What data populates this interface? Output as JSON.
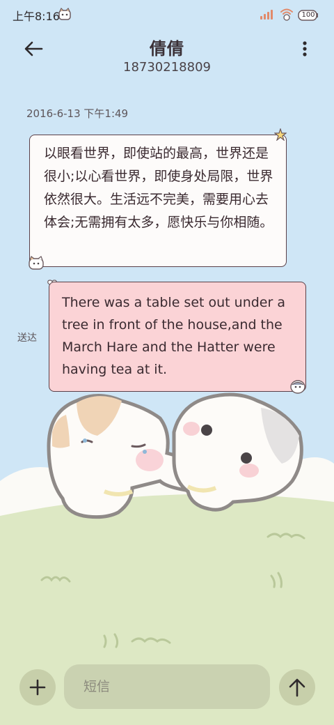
{
  "status_bar": {
    "time": "上午8:16",
    "battery": "100"
  },
  "header": {
    "contact_name": "倩倩",
    "phone_number": "18730218809"
  },
  "conversation": {
    "timestamp": "2016-6-13 下午1:49",
    "messages": [
      {
        "direction": "incoming",
        "text": "以眼看世界，即使站的最高，世界还是很小;以心看世界，即使身处局限，世界依然很大。生活远不完美，需要用心去体会;无需拥有太多，愿快乐与你相随。"
      },
      {
        "direction": "outgoing",
        "text": "There was a table set out under a tree in front of the house,and the March Hare and the Hatter were having tea at it.",
        "status": "送达"
      }
    ]
  },
  "composer": {
    "placeholder": "短信"
  },
  "icons": {
    "back": "arrow-left-icon",
    "more": "more-vertical-icon",
    "add": "plus-icon",
    "send": "arrow-up-icon"
  },
  "colors": {
    "sky": "#cfe6f6",
    "grass": "#dde8c4",
    "outgoing_bubble": "#fbd3d6",
    "incoming_bubble": "#fdfbfa",
    "bubble_border": "#5a4048"
  }
}
